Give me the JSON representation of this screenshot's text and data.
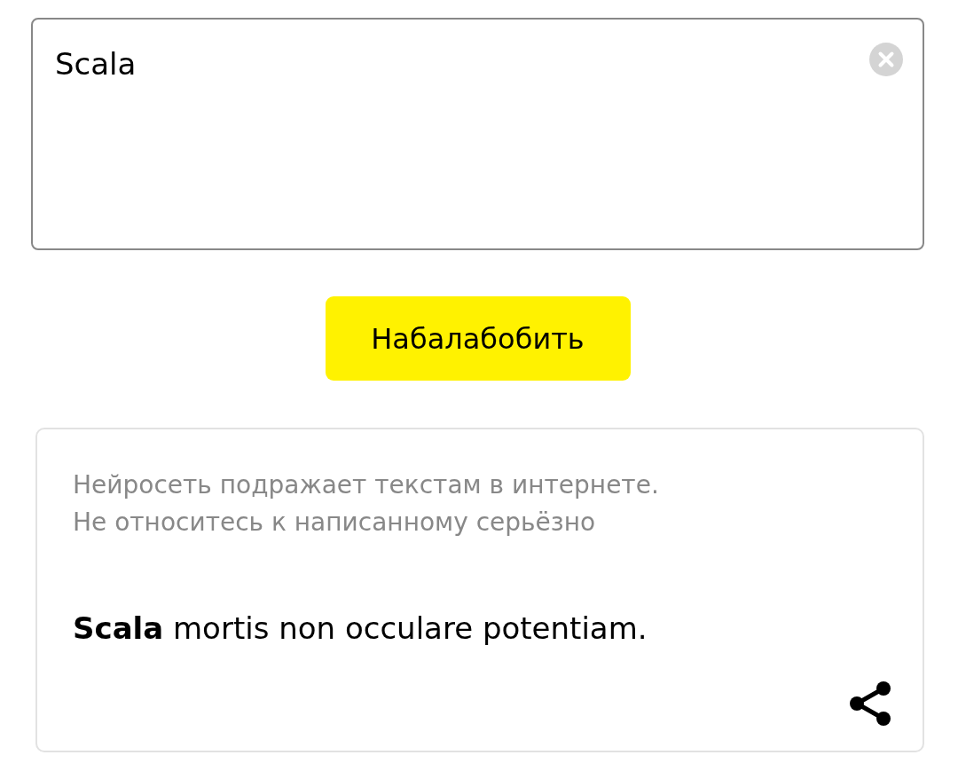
{
  "input": {
    "value": "Scala"
  },
  "button": {
    "label": "Набалабобить"
  },
  "result": {
    "disclaimer": [
      "Нейросеть подражает текстам в интернете.",
      "Не относитесь к написанному серьёзно"
    ],
    "text": "**Scala** mortis non occulare potentiam."
  }
}
